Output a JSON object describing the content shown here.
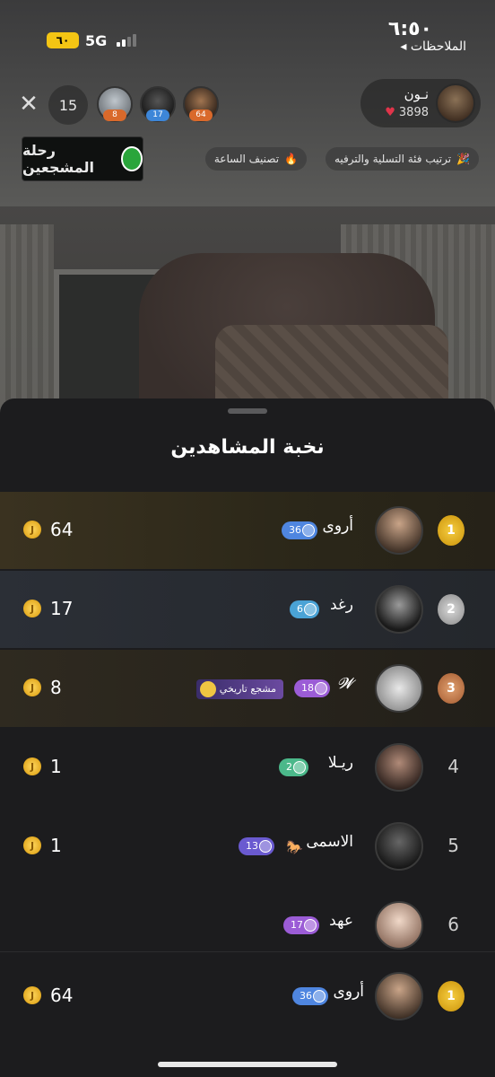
{
  "status_bar": {
    "time": "٦:٥٠",
    "back_label": "◂ الملاحظات",
    "battery": "٦٠",
    "network": "5G"
  },
  "host": {
    "name": "نـون",
    "likes": "3898"
  },
  "viewers": [
    {
      "badge": "64",
      "color": "#d9692b"
    },
    {
      "badge": "17",
      "color": "#3d86d8"
    },
    {
      "badge": "8",
      "color": "#d9692b"
    }
  ],
  "viewer_count": "15",
  "chips": {
    "category": "ترتيب فئة التسلية والترفيه",
    "hourly": "تصنيف الساعة"
  },
  "logo_text": "رحلة المشجعين",
  "sheet_title": "نخبة المشاهدين",
  "rows": [
    {
      "rank": "1",
      "name": "أروى",
      "level": "36",
      "level_color": "#4f86e0",
      "coins": "64"
    },
    {
      "rank": "2",
      "name": "رغد",
      "level": "6",
      "level_color": "#4aa3d6",
      "coins": "17"
    },
    {
      "rank": "3",
      "name": "𝓦",
      "level": "18",
      "level_color": "#9b5cd6",
      "title": "مشجع تاريخي",
      "coins": "8"
    },
    {
      "rank": "4",
      "name": "ريـلا",
      "level": "2",
      "level_color": "#4bb88a",
      "coins": "1"
    },
    {
      "rank": "5",
      "name": "الاسمى",
      "emoji": "🐎",
      "level": "13",
      "level_color": "#6a5ad0",
      "coins": "1"
    },
    {
      "rank": "6",
      "name": "عهد",
      "level": "17",
      "level_color": "#9b5cd6",
      "coins": ""
    }
  ],
  "me": {
    "rank": "1",
    "name": "أروى",
    "level": "36",
    "level_color": "#4f86e0",
    "coins": "64"
  },
  "coin_symbol": "J",
  "icons": {
    "close": "close-icon",
    "heart": "heart-icon",
    "fire": "fire-icon",
    "confetti": "confetti-icon"
  }
}
